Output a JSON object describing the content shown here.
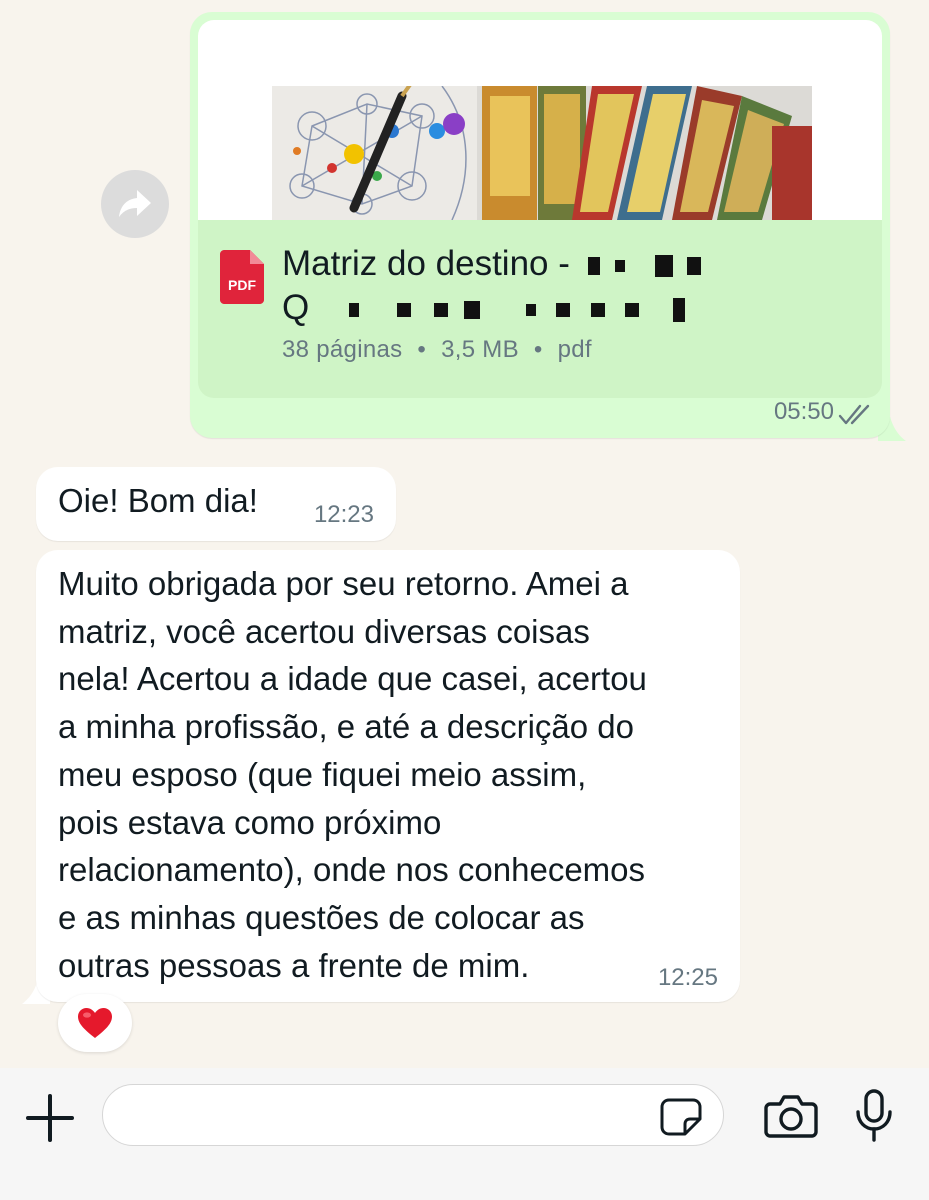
{
  "outgoing_document": {
    "file_title_visible": "Matriz do destino -",
    "file_title_line2_start": "Q",
    "file_icon_label": "PDF",
    "pages": "38 páginas",
    "size": "3,5 MB",
    "type": "pdf",
    "separator": "•",
    "time": "05:50",
    "status_icon": "double-check-icon"
  },
  "forward_icon": "forward-arrow-icon",
  "messages": [
    {
      "text": "Oie! Bom dia!",
      "time": "12:23"
    },
    {
      "lines": [
        "Muito obrigada por seu retorno. Amei a",
        "matriz, você acertou diversas coisas",
        "nela! Acertou a idade que casei, acertou",
        "a minha profissão, e até a descrição do",
        "meu esposo (que fiquei meio assim,",
        "pois estava como próximo",
        "relacionamento), onde nos conhecemos",
        "e as minhas questões de colocar as",
        "outras pessoas a frente de mim."
      ],
      "time": "12:25",
      "reaction": "❤️"
    }
  ],
  "input_bar": {
    "plus_icon": "plus-icon",
    "message_value": "",
    "message_placeholder": "",
    "sticker_icon": "sticker-icon",
    "camera_icon": "camera-icon",
    "mic_icon": "microphone-icon"
  },
  "colors": {
    "background": "#f8f4ed",
    "outgoing_bubble": "#d9fdd3",
    "incoming_bubble": "#ffffff",
    "pdf_red": "#e0243b",
    "meta_text": "#667781"
  }
}
